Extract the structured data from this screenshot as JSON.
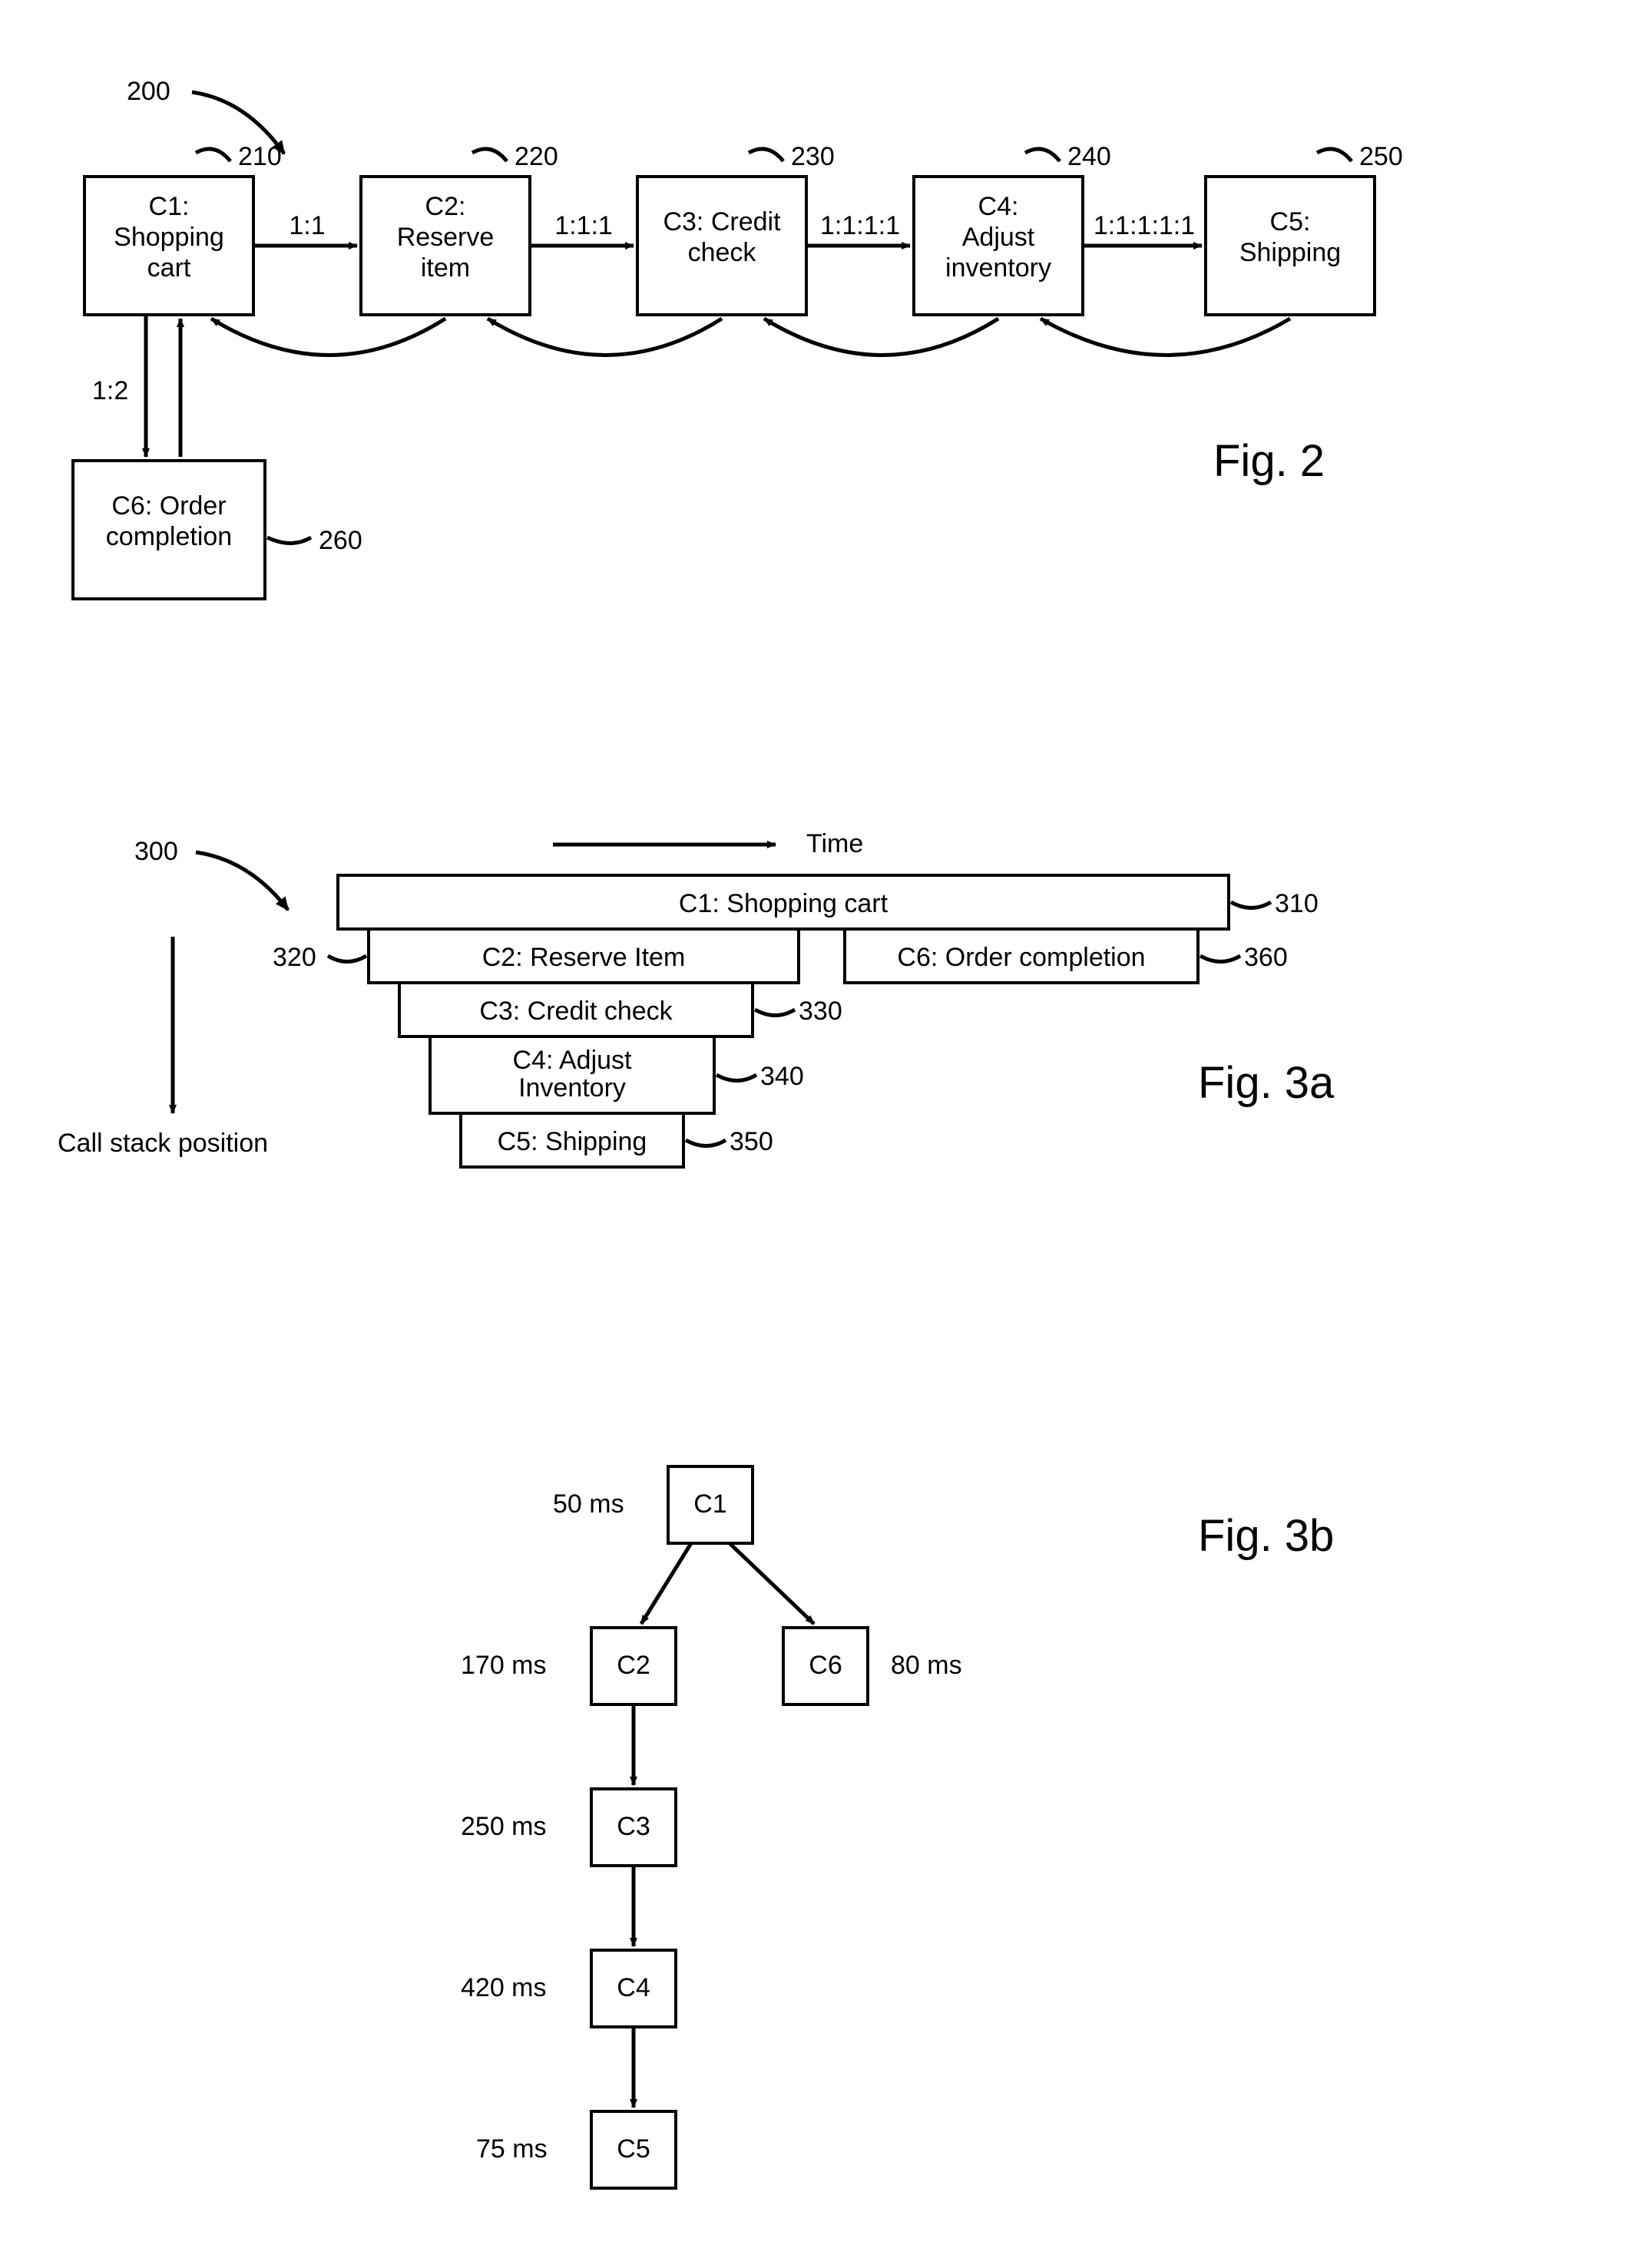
{
  "fig2": {
    "label": "Fig. 2",
    "pointer": "200",
    "blocks": {
      "c1": {
        "ref": "210",
        "l1": "C1:",
        "l2": "Shopping",
        "l3": "cart"
      },
      "c2": {
        "ref": "220",
        "l1": "C2:",
        "l2": "Reserve",
        "l3": "item"
      },
      "c3": {
        "ref": "230",
        "l1": "C3: Credit",
        "l2": "check"
      },
      "c4": {
        "ref": "240",
        "l1": "C4:",
        "l2": "Adjust",
        "l3": "inventory"
      },
      "c5": {
        "ref": "250",
        "l1": "C5:",
        "l2": "Shipping"
      },
      "c6": {
        "ref": "260",
        "l1": "C6: Order",
        "l2": "completion"
      }
    },
    "edges": {
      "e12": "1:1",
      "e23": "1:1:1",
      "e34": "1:1:1:1",
      "e45": "1:1:1:1:1",
      "e16": "1:2"
    }
  },
  "fig3a": {
    "label": "Fig. 3a",
    "pointer": "300",
    "timeLabel": "Time",
    "stackLabel": "Call stack position",
    "bars": {
      "b1": {
        "ref": "310",
        "text": "C1: Shopping  cart"
      },
      "b2": {
        "ref": "320",
        "text": "C2: Reserve Item"
      },
      "b3": {
        "ref": "330",
        "text": "C3: Credit check"
      },
      "b4": {
        "ref": "340",
        "text": "C4: Adjust",
        "text2": "Inventory"
      },
      "b5": {
        "ref": "350",
        "text": "C5: Shipping"
      },
      "b6": {
        "ref": "360",
        "text": "C6: Order completion"
      }
    }
  },
  "fig3b": {
    "label": "Fig. 3b",
    "nodes": {
      "n1": {
        "name": "C1",
        "time": "50 ms"
      },
      "n2": {
        "name": "C2",
        "time": "170 ms"
      },
      "n3": {
        "name": "C3",
        "time": "250 ms"
      },
      "n4": {
        "name": "C4",
        "time": "420 ms"
      },
      "n5": {
        "name": "C5",
        "time": "75 ms"
      },
      "n6": {
        "name": "C6",
        "time": "80 ms"
      }
    }
  },
  "chart_data": [
    {
      "type": "diagram",
      "figure": "Fig. 2",
      "nodes": [
        {
          "id": "C1",
          "label": "Shopping cart",
          "ref": 210
        },
        {
          "id": "C2",
          "label": "Reserve item",
          "ref": 220
        },
        {
          "id": "C3",
          "label": "Credit check",
          "ref": 230
        },
        {
          "id": "C4",
          "label": "Adjust inventory",
          "ref": 240
        },
        {
          "id": "C5",
          "label": "Shipping",
          "ref": 250
        },
        {
          "id": "C6",
          "label": "Order completion",
          "ref": 260
        }
      ],
      "edges": [
        {
          "from": "C1",
          "to": "C2",
          "label": "1:1"
        },
        {
          "from": "C2",
          "to": "C3",
          "label": "1:1:1"
        },
        {
          "from": "C3",
          "to": "C4",
          "label": "1:1:1:1"
        },
        {
          "from": "C4",
          "to": "C5",
          "label": "1:1:1:1:1"
        },
        {
          "from": "C1",
          "to": "C6",
          "label": "1:2"
        },
        {
          "from": "C2",
          "to": "C1",
          "return": true
        },
        {
          "from": "C3",
          "to": "C2",
          "return": true
        },
        {
          "from": "C4",
          "to": "C3",
          "return": true
        },
        {
          "from": "C5",
          "to": "C4",
          "return": true
        },
        {
          "from": "C6",
          "to": "C1",
          "return": true
        }
      ],
      "pointer": 200
    },
    {
      "type": "diagram",
      "figure": "Fig. 3a",
      "pointer": 300,
      "axes": {
        "x": "Time",
        "y": "Call stack position"
      },
      "bars": [
        {
          "id": "C1",
          "label": "Shopping cart",
          "ref": 310,
          "depth": 0
        },
        {
          "id": "C2",
          "label": "Reserve Item",
          "ref": 320,
          "depth": 1
        },
        {
          "id": "C3",
          "label": "Credit check",
          "ref": 330,
          "depth": 2
        },
        {
          "id": "C4",
          "label": "Adjust Inventory",
          "ref": 340,
          "depth": 3
        },
        {
          "id": "C5",
          "label": "Shipping",
          "ref": 350,
          "depth": 4
        },
        {
          "id": "C6",
          "label": "Order completion",
          "ref": 360,
          "depth": 1
        }
      ]
    },
    {
      "type": "diagram",
      "figure": "Fig. 3b",
      "subtype": "tree",
      "nodes": [
        {
          "id": "C1",
          "time_ms": 50
        },
        {
          "id": "C2",
          "time_ms": 170,
          "parent": "C1"
        },
        {
          "id": "C6",
          "time_ms": 80,
          "parent": "C1"
        },
        {
          "id": "C3",
          "time_ms": 250,
          "parent": "C2"
        },
        {
          "id": "C4",
          "time_ms": 420,
          "parent": "C3"
        },
        {
          "id": "C5",
          "time_ms": 75,
          "parent": "C4"
        }
      ]
    }
  ]
}
